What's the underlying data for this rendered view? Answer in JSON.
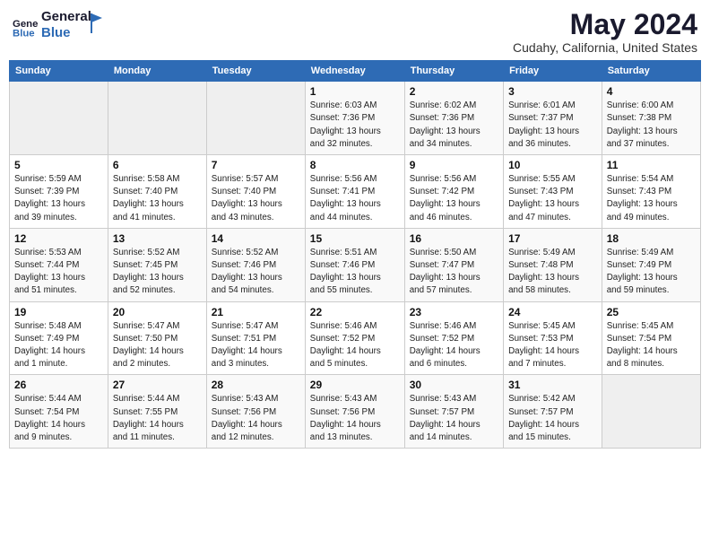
{
  "header": {
    "logo_line1": "General",
    "logo_line2": "Blue",
    "month": "May 2024",
    "location": "Cudahy, California, United States"
  },
  "weekdays": [
    "Sunday",
    "Monday",
    "Tuesday",
    "Wednesday",
    "Thursday",
    "Friday",
    "Saturday"
  ],
  "weeks": [
    [
      {
        "day": "",
        "info": ""
      },
      {
        "day": "",
        "info": ""
      },
      {
        "day": "",
        "info": ""
      },
      {
        "day": "1",
        "info": "Sunrise: 6:03 AM\nSunset: 7:36 PM\nDaylight: 13 hours\nand 32 minutes."
      },
      {
        "day": "2",
        "info": "Sunrise: 6:02 AM\nSunset: 7:36 PM\nDaylight: 13 hours\nand 34 minutes."
      },
      {
        "day": "3",
        "info": "Sunrise: 6:01 AM\nSunset: 7:37 PM\nDaylight: 13 hours\nand 36 minutes."
      },
      {
        "day": "4",
        "info": "Sunrise: 6:00 AM\nSunset: 7:38 PM\nDaylight: 13 hours\nand 37 minutes."
      }
    ],
    [
      {
        "day": "5",
        "info": "Sunrise: 5:59 AM\nSunset: 7:39 PM\nDaylight: 13 hours\nand 39 minutes."
      },
      {
        "day": "6",
        "info": "Sunrise: 5:58 AM\nSunset: 7:40 PM\nDaylight: 13 hours\nand 41 minutes."
      },
      {
        "day": "7",
        "info": "Sunrise: 5:57 AM\nSunset: 7:40 PM\nDaylight: 13 hours\nand 43 minutes."
      },
      {
        "day": "8",
        "info": "Sunrise: 5:56 AM\nSunset: 7:41 PM\nDaylight: 13 hours\nand 44 minutes."
      },
      {
        "day": "9",
        "info": "Sunrise: 5:56 AM\nSunset: 7:42 PM\nDaylight: 13 hours\nand 46 minutes."
      },
      {
        "day": "10",
        "info": "Sunrise: 5:55 AM\nSunset: 7:43 PM\nDaylight: 13 hours\nand 47 minutes."
      },
      {
        "day": "11",
        "info": "Sunrise: 5:54 AM\nSunset: 7:43 PM\nDaylight: 13 hours\nand 49 minutes."
      }
    ],
    [
      {
        "day": "12",
        "info": "Sunrise: 5:53 AM\nSunset: 7:44 PM\nDaylight: 13 hours\nand 51 minutes."
      },
      {
        "day": "13",
        "info": "Sunrise: 5:52 AM\nSunset: 7:45 PM\nDaylight: 13 hours\nand 52 minutes."
      },
      {
        "day": "14",
        "info": "Sunrise: 5:52 AM\nSunset: 7:46 PM\nDaylight: 13 hours\nand 54 minutes."
      },
      {
        "day": "15",
        "info": "Sunrise: 5:51 AM\nSunset: 7:46 PM\nDaylight: 13 hours\nand 55 minutes."
      },
      {
        "day": "16",
        "info": "Sunrise: 5:50 AM\nSunset: 7:47 PM\nDaylight: 13 hours\nand 57 minutes."
      },
      {
        "day": "17",
        "info": "Sunrise: 5:49 AM\nSunset: 7:48 PM\nDaylight: 13 hours\nand 58 minutes."
      },
      {
        "day": "18",
        "info": "Sunrise: 5:49 AM\nSunset: 7:49 PM\nDaylight: 13 hours\nand 59 minutes."
      }
    ],
    [
      {
        "day": "19",
        "info": "Sunrise: 5:48 AM\nSunset: 7:49 PM\nDaylight: 14 hours\nand 1 minute."
      },
      {
        "day": "20",
        "info": "Sunrise: 5:47 AM\nSunset: 7:50 PM\nDaylight: 14 hours\nand 2 minutes."
      },
      {
        "day": "21",
        "info": "Sunrise: 5:47 AM\nSunset: 7:51 PM\nDaylight: 14 hours\nand 3 minutes."
      },
      {
        "day": "22",
        "info": "Sunrise: 5:46 AM\nSunset: 7:52 PM\nDaylight: 14 hours\nand 5 minutes."
      },
      {
        "day": "23",
        "info": "Sunrise: 5:46 AM\nSunset: 7:52 PM\nDaylight: 14 hours\nand 6 minutes."
      },
      {
        "day": "24",
        "info": "Sunrise: 5:45 AM\nSunset: 7:53 PM\nDaylight: 14 hours\nand 7 minutes."
      },
      {
        "day": "25",
        "info": "Sunrise: 5:45 AM\nSunset: 7:54 PM\nDaylight: 14 hours\nand 8 minutes."
      }
    ],
    [
      {
        "day": "26",
        "info": "Sunrise: 5:44 AM\nSunset: 7:54 PM\nDaylight: 14 hours\nand 9 minutes."
      },
      {
        "day": "27",
        "info": "Sunrise: 5:44 AM\nSunset: 7:55 PM\nDaylight: 14 hours\nand 11 minutes."
      },
      {
        "day": "28",
        "info": "Sunrise: 5:43 AM\nSunset: 7:56 PM\nDaylight: 14 hours\nand 12 minutes."
      },
      {
        "day": "29",
        "info": "Sunrise: 5:43 AM\nSunset: 7:56 PM\nDaylight: 14 hours\nand 13 minutes."
      },
      {
        "day": "30",
        "info": "Sunrise: 5:43 AM\nSunset: 7:57 PM\nDaylight: 14 hours\nand 14 minutes."
      },
      {
        "day": "31",
        "info": "Sunrise: 5:42 AM\nSunset: 7:57 PM\nDaylight: 14 hours\nand 15 minutes."
      },
      {
        "day": "",
        "info": ""
      }
    ]
  ]
}
